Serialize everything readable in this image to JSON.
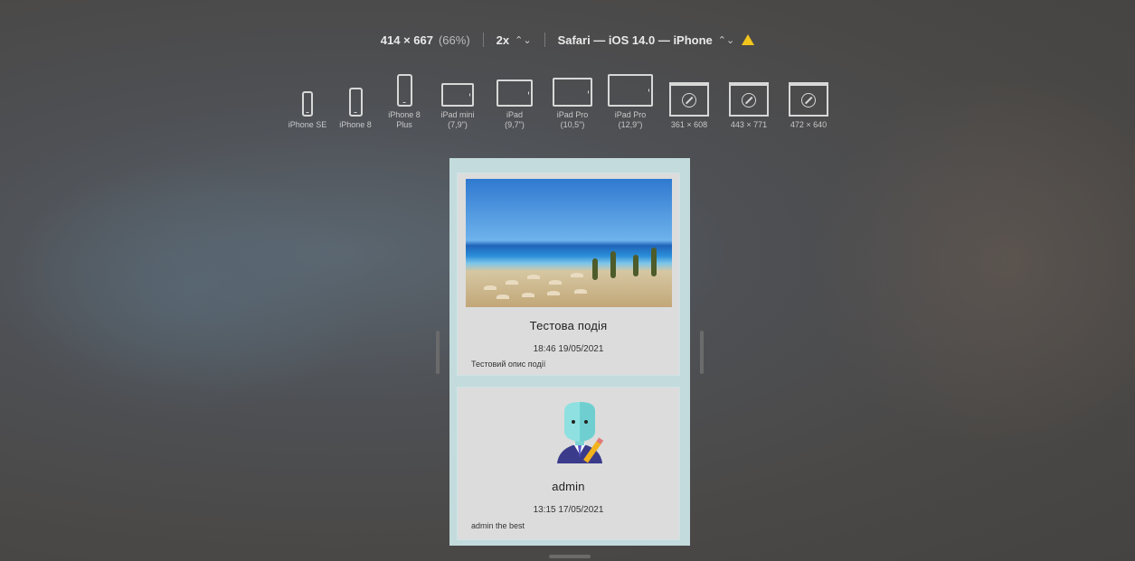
{
  "toolbar": {
    "size": "414 × 667",
    "zoom": "(66%)",
    "scale": "2x",
    "scale_stepper": "⌃⌄",
    "browser": "Safari — iOS 14.0 — iPhone",
    "browser_stepper": "⌃⌄"
  },
  "devices": [
    {
      "label": "iPhone SE"
    },
    {
      "label": "iPhone 8"
    },
    {
      "label": "iPhone 8 Plus"
    },
    {
      "label": "iPad mini (7,9\")"
    },
    {
      "label": "iPad (9,7\")"
    },
    {
      "label": "iPad Pro (10,5\")"
    },
    {
      "label": "iPad Pro (12,9\")"
    },
    {
      "label": "361 × 608"
    },
    {
      "label": "443 × 771"
    },
    {
      "label": "472 × 640"
    }
  ],
  "feed": {
    "posts": [
      {
        "title": "Тестова подія",
        "time": "18:46 19/05/2021",
        "description": "Тестовий опис події"
      },
      {
        "title": "admin",
        "time": "13:15 17/05/2021",
        "description": "admin the best"
      }
    ]
  }
}
